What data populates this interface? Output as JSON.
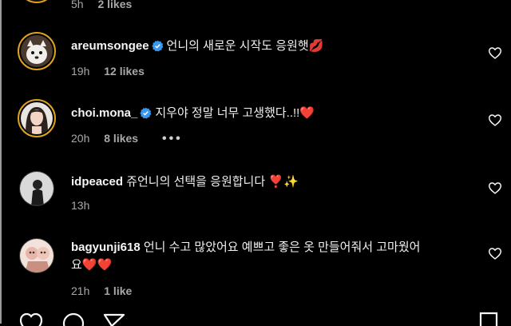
{
  "partial_comment": {
    "time": "5h",
    "likes": "2 likes"
  },
  "comments": [
    {
      "username": "areumsongee",
      "verified": true,
      "text": "언니의 새로운 시작도 응원햇💋",
      "time": "19h",
      "likes": "12 likes"
    },
    {
      "username": "choi.mona_",
      "verified": true,
      "text": "지우야 정말 너무 고생했다..!!❤️",
      "time": "20h",
      "likes": "8 likes",
      "more": "•••"
    },
    {
      "username": "idpeaced",
      "verified": false,
      "text": "쥬언니의 선택을 응원합니다 ❣️✨",
      "time": "13h",
      "likes": ""
    },
    {
      "username": "bagyunji618",
      "verified": false,
      "text_line1": "언니 수고 많았어요 예쁘고 좋은 옷 만들어줘서 고마웠어",
      "text_line2": "요❤️❤️",
      "time": "21h",
      "likes": "1 like"
    }
  ],
  "icons": {
    "like_comment": "heart-outline-icon",
    "verified": "verified-badge-icon",
    "actions": [
      "heart-icon",
      "comment-icon",
      "share-icon",
      "save-icon"
    ]
  },
  "colors": {
    "background": "#000000",
    "verified": "#3897f0",
    "story_ring": "#e0a21c",
    "meta": "#a8a8a8"
  }
}
